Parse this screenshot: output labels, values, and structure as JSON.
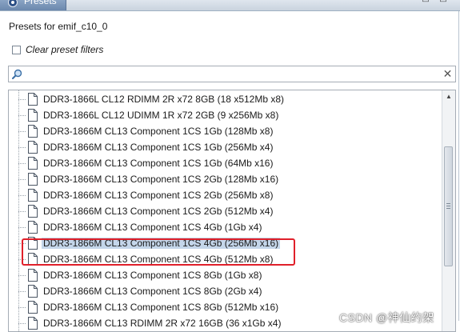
{
  "window": {
    "tab_title": "Presets",
    "tab_icon": "preset-icon",
    "controls": [
      "minimize-icon",
      "close-icon"
    ]
  },
  "panel": {
    "heading": "Presets for emif_c10_0",
    "clear_filters_label": "Clear preset filters",
    "clear_filters_checked": false,
    "search": {
      "value": "",
      "placeholder": "",
      "icon": "search-icon",
      "clear_icon": "clear-icon"
    }
  },
  "tree": {
    "item_icon": "document-icon",
    "items": [
      {
        "label": "DDR3-1866L CL12 RDIMM 2R x72 8GB (18 x512Mb x8)",
        "selected": false
      },
      {
        "label": "DDR3-1866L CL12 UDIMM 1R x72 2GB (9 x256Mb x8)",
        "selected": false
      },
      {
        "label": "DDR3-1866M CL13 Component 1CS 1Gb (128Mb x8)",
        "selected": false
      },
      {
        "label": "DDR3-1866M CL13 Component 1CS 1Gb (256Mb x4)",
        "selected": false
      },
      {
        "label": "DDR3-1866M CL13 Component 1CS 1Gb (64Mb x16)",
        "selected": false
      },
      {
        "label": "DDR3-1866M CL13 Component 1CS 2Gb (128Mb x16)",
        "selected": false
      },
      {
        "label": "DDR3-1866M CL13 Component 1CS 2Gb (256Mb x8)",
        "selected": false
      },
      {
        "label": "DDR3-1866M CL13 Component 1CS 2Gb (512Mb x4)",
        "selected": false
      },
      {
        "label": "DDR3-1866M CL13 Component 1CS 4Gb (1Gb x4)",
        "selected": false
      },
      {
        "label": "DDR3-1866M CL13 Component 1CS 4Gb (256Mb x16)",
        "selected": true
      },
      {
        "label": "DDR3-1866M CL13 Component 1CS 4Gb (512Mb x8)",
        "selected": false
      },
      {
        "label": "DDR3-1866M CL13 Component 1CS 8Gb (1Gb x8)",
        "selected": false
      },
      {
        "label": "DDR3-1866M CL13 Component 1CS 8Gb (2Gb x4)",
        "selected": false
      },
      {
        "label": "DDR3-1866M CL13 Component 1CS 8Gb (512Mb x16)",
        "selected": false
      },
      {
        "label": "DDR3-1866M CL13 RDIMM 2R x72 16GB (36 x1Gb x4)",
        "selected": false
      }
    ]
  },
  "annotation": {
    "highlight_color": "#e0202a"
  },
  "watermark": {
    "text": "CSDN @神仙约架"
  },
  "colors": {
    "selection": "#c4d6ea",
    "tab_active": "#6b88ad",
    "border": "#a5acb5"
  }
}
